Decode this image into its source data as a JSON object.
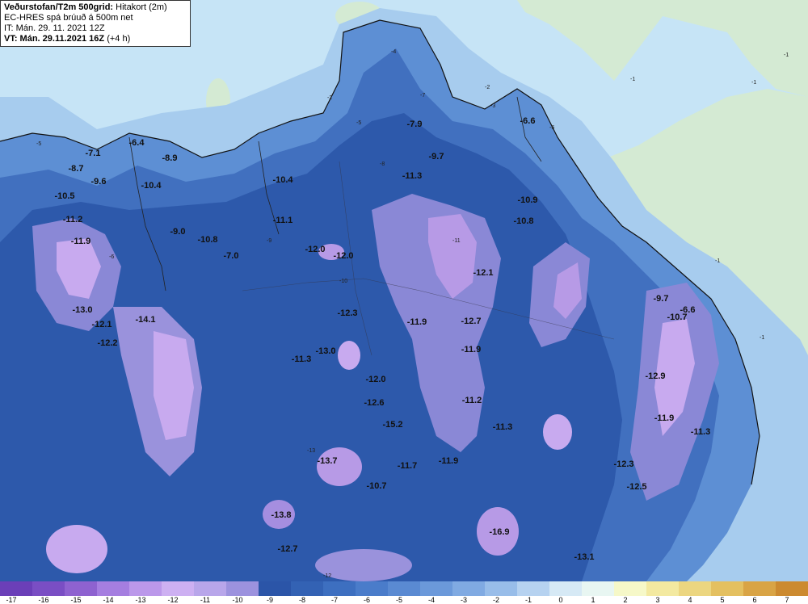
{
  "info": {
    "title": "Veðurstofan/T2m 500grid:",
    "subtitle": "Hitakort (2m)",
    "line2": "EC-HRES spá brúuð á 500m net",
    "line3": "IT: Mán. 29. 11. 2021 12Z",
    "line4_bold": "VT: Mán. 29.11.2021 16Z",
    "line4_rest": "(+4 h)"
  },
  "legend": {
    "colors": [
      "#6b3fb8",
      "#7a4ec4",
      "#8e62d0",
      "#a57ee0",
      "#bb98ea",
      "#cdb0f2",
      "#b8a6ea",
      "#9c92de",
      "#2b55a8",
      "#3362b4",
      "#3d6fc0",
      "#4a7cca",
      "#5a8ad2",
      "#6b99da",
      "#80aae2",
      "#98bde9",
      "#b6d2f0",
      "#d6e9f5",
      "#e8f6f2",
      "#f6f8c8",
      "#f3e9a0",
      "#ecd680",
      "#e4c060",
      "#d9a445",
      "#cc8a30"
    ],
    "ticks": [
      "-17",
      "-16",
      "-15",
      "-14",
      "-13",
      "-12",
      "-11",
      "-10",
      "-9",
      "-8",
      "-7",
      "-6",
      "-5",
      "-4",
      "-3",
      "-2",
      "-1",
      "0",
      "1",
      "2",
      "3",
      "4",
      "5",
      "6",
      "7"
    ]
  },
  "labels": [
    {
      "t": "-7.1"
    },
    {
      "t": "-8.7"
    },
    {
      "t": "-9.6"
    },
    {
      "t": "-10.5"
    },
    {
      "t": "-11.2"
    },
    {
      "t": "-11.9"
    },
    {
      "t": "-13.0"
    },
    {
      "t": "-12.1"
    },
    {
      "t": "-14.1"
    },
    {
      "t": "-12.2"
    },
    {
      "t": "-6.4"
    },
    {
      "t": "-8.9"
    },
    {
      "t": "-10.4"
    },
    {
      "t": "-9.0"
    },
    {
      "t": "-10.8"
    },
    {
      "t": "-7.0"
    },
    {
      "t": "-10.4"
    },
    {
      "t": "-11.1"
    },
    {
      "t": "-12.0"
    },
    {
      "t": "-12.0"
    },
    {
      "t": "-12.3"
    },
    {
      "t": "-13.0"
    },
    {
      "t": "-11.3"
    },
    {
      "t": "-7.9"
    },
    {
      "t": "-9.7"
    },
    {
      "t": "-6.6"
    },
    {
      "t": "-11.3"
    },
    {
      "t": "-10.9"
    },
    {
      "t": "-10.8"
    },
    {
      "t": "-12.1"
    },
    {
      "t": "-11.9"
    },
    {
      "t": "-12.7"
    },
    {
      "t": "-11.9"
    },
    {
      "t": "-12.0"
    },
    {
      "t": "-12.6"
    },
    {
      "t": "-11.2"
    },
    {
      "t": "-15.2"
    },
    {
      "t": "-11.3"
    },
    {
      "t": "-13.7"
    },
    {
      "t": "-11.7"
    },
    {
      "t": "-11.9"
    },
    {
      "t": "-10.7"
    },
    {
      "t": "-13.8"
    },
    {
      "t": "-16.9"
    },
    {
      "t": "-12.7"
    },
    {
      "t": "-13.1"
    },
    {
      "t": "-9.7"
    },
    {
      "t": "-6.6"
    },
    {
      "t": "-10.7"
    },
    {
      "t": "-12.9"
    },
    {
      "t": "-11.9"
    },
    {
      "t": "-11.3"
    },
    {
      "t": "-12.3"
    },
    {
      "t": "-12.5"
    }
  ],
  "small_labels": [
    "-1",
    "-1",
    "-1",
    "-1",
    "-1",
    "-2",
    "-2",
    "-3",
    "-4",
    "-5",
    "-5",
    "-6",
    "-6",
    "-7",
    "-8",
    "-9",
    "-10",
    "-11",
    "-12",
    "-13"
  ]
}
